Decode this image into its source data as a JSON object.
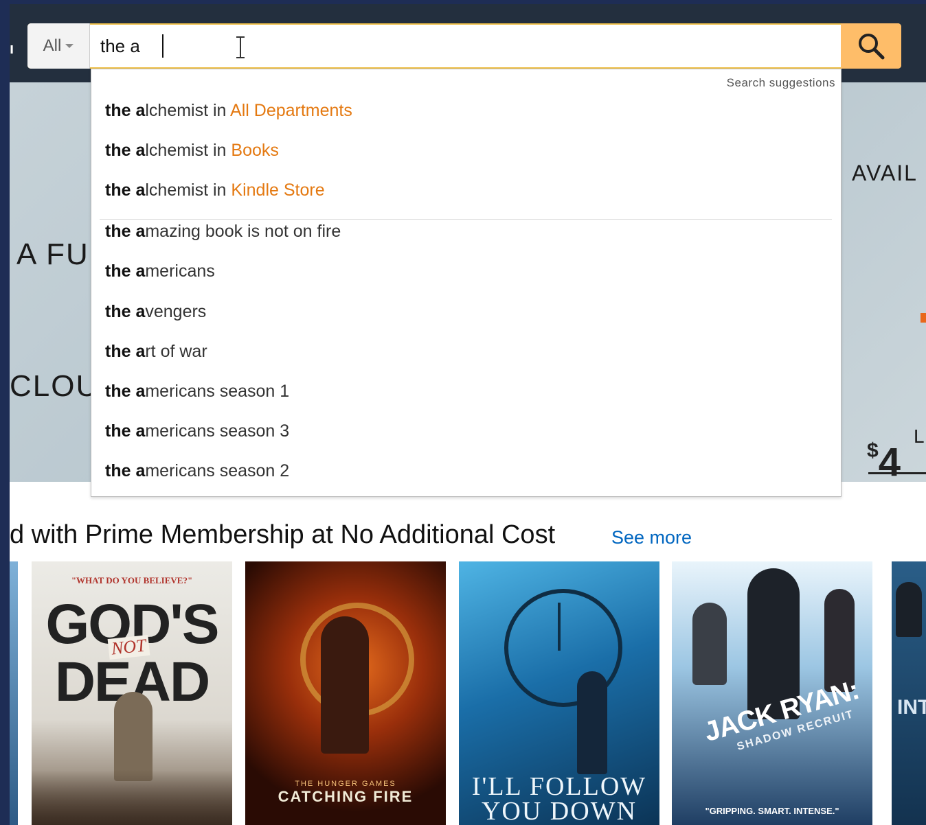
{
  "search": {
    "category": "All",
    "query": "the a"
  },
  "hero": {
    "left_line1": "A FU",
    "left_line2": "CLOU",
    "right_top": "AVAIL",
    "right_price": "4",
    "right_currency": "$",
    "right_bottom": "L"
  },
  "suggestions": {
    "header": "Search suggestions",
    "department_items": [
      {
        "bold": "the a",
        "rest": "lchemist in ",
        "dept": "All Departments"
      },
      {
        "bold": "the a",
        "rest": "lchemist in ",
        "dept": "Books"
      },
      {
        "bold": "the a",
        "rest": "lchemist in ",
        "dept": "Kindle Store"
      }
    ],
    "items": [
      {
        "bold": "the a",
        "rest": "mazing book is not on fire"
      },
      {
        "bold": "the a",
        "rest": "mericans"
      },
      {
        "bold": "the a",
        "rest": "vengers"
      },
      {
        "bold": "the a",
        "rest": "rt of war"
      },
      {
        "bold": "the a",
        "rest": "mericans season 1"
      },
      {
        "bold": "the a",
        "rest": "mericans season 3"
      },
      {
        "bold": "the a",
        "rest": "mericans season 2"
      }
    ]
  },
  "prime_row": {
    "title": "d with Prime Membership at No Additional Cost",
    "see_more": "See more",
    "posters": [
      {
        "title": "GOD'S DEAD",
        "tagline": "\"WHAT DO YOU BELIEVE?\"",
        "overlay": "NOT"
      },
      {
        "title": "CATCHING FIRE",
        "tagline": "THE HUNGER GAMES"
      },
      {
        "title": "I'LL FOLLOW YOU DOWN"
      },
      {
        "title": "JACK RYAN:",
        "subtitle": "SHADOW RECRUIT",
        "quote": "\"GRIPPING. SMART. INTENSE.\""
      },
      {
        "title": "INT"
      }
    ]
  }
}
